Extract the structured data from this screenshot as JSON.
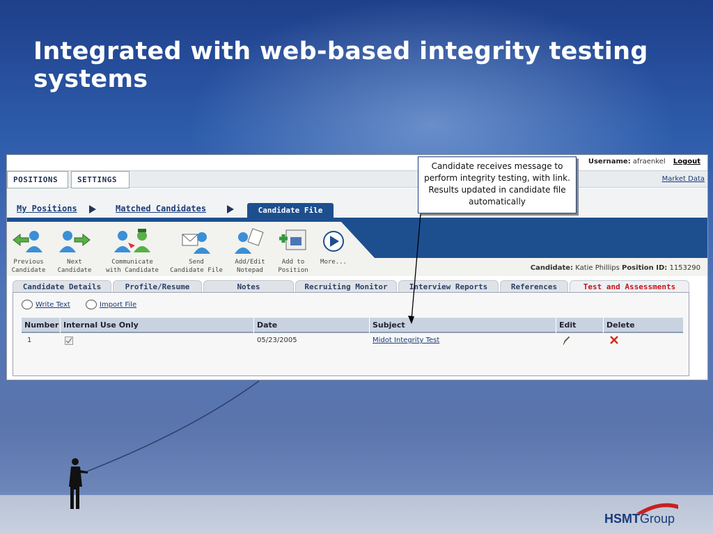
{
  "slide": {
    "title": "Integrated with web-based integrity testing systems",
    "callout": "Candidate receives message to perform integrity testing, with link. Results updated in candidate file automatically"
  },
  "userbar": {
    "username_label": "Username:",
    "username": "afraenkel",
    "logout": "Logout"
  },
  "topnav": {
    "positions": "POSITIONS",
    "settings": "SETTINGS",
    "market_data": "Market Data"
  },
  "breadcrumb": {
    "my_positions": "My Positions",
    "matched_candidates": "Matched Candidates",
    "candidate_file": "Candidate File"
  },
  "toolbar": {
    "items": [
      {
        "label1": "Previous",
        "label2": "Candidate"
      },
      {
        "label1": "Next",
        "label2": "Candidate"
      },
      {
        "label1": "Communicate",
        "label2": "with Candidate"
      },
      {
        "label1": "Send",
        "label2": "Candidate File"
      },
      {
        "label1": "Add/Edit",
        "label2": "Notepad"
      },
      {
        "label1": "Add to",
        "label2": "Position"
      },
      {
        "label1": "More...",
        "label2": ""
      }
    ]
  },
  "candidate": {
    "candidate_label": "Candidate:",
    "name": "Katie Phillips",
    "position_label": "Position ID:",
    "position_id": "1153290"
  },
  "tabs": [
    "Candidate Details",
    "Profile/Resume",
    "Notes",
    "Recruiting Monitor",
    "Interview Reports",
    "References",
    "Test and Assessments"
  ],
  "panel": {
    "write_text": "Write Text",
    "import_file": "Import File",
    "columns": [
      "Number",
      "Internal Use Only",
      "Date",
      "Subject",
      "Edit",
      "Delete"
    ],
    "rows": [
      {
        "number": "1",
        "internal_use_only": true,
        "date": "05/23/2005",
        "subject": "Midot Integrity Test"
      }
    ]
  },
  "logo": {
    "brand_bold": "HSMT",
    "brand_light": "Group"
  },
  "colors": {
    "accent": "#1d4f8f",
    "active_tab": "#c0181e",
    "link": "#1a3a7a"
  }
}
